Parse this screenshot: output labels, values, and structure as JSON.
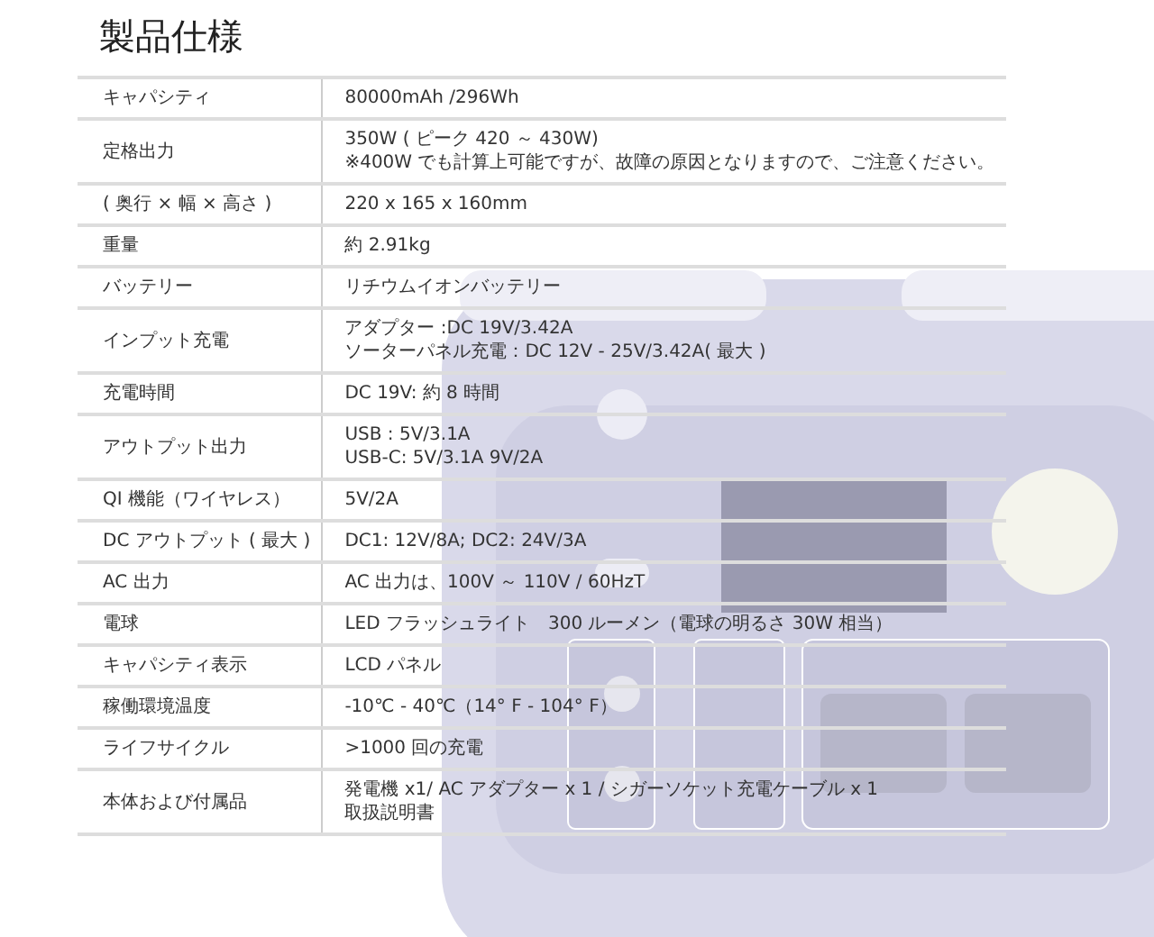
{
  "title": "製品仕様",
  "specs": [
    {
      "label": "キャパシティ",
      "lines": [
        "80000mAh /296Wh"
      ]
    },
    {
      "label": "定格出力",
      "lines": [
        "350W ( ピーク 420 ～ 430W)",
        "※400W でも計算上可能ですが、故障の原因となりますので、ご注意ください。"
      ]
    },
    {
      "label": "( 奥行 × 幅 × 高さ )",
      "lines": [
        "220 x 165 x 160mm"
      ]
    },
    {
      "label": "重量",
      "lines": [
        "約 2.91kg"
      ]
    },
    {
      "label": "バッテリー",
      "lines": [
        "リチウムイオンバッテリー"
      ]
    },
    {
      "label": "インプット充電",
      "lines": [
        "アダプター :DC 19V/3.42A",
        "ソーターパネル充電：DC 12V - 25V/3.42A( 最大 )"
      ]
    },
    {
      "label": "充電時間",
      "lines": [
        "DC 19V: 約 8 時間"
      ]
    },
    {
      "label": "アウトプット出力",
      "lines": [
        "USB : 5V/3.1A",
        "USB-C: 5V/3.1A 9V/2A"
      ]
    },
    {
      "label": "QI 機能（ワイヤレス）",
      "lines": [
        "5V/2A"
      ]
    },
    {
      "label": "DC アウトプット ( 最大 )",
      "lines": [
        "DC1: 12V/8A; DC2: 24V/3A"
      ]
    },
    {
      "label": "AC 出力",
      "lines": [
        "AC 出力は、100V ～ 110V / 60HzT"
      ]
    },
    {
      "label": "電球",
      "lines": [
        "LED フラッシュライト　300 ルーメン（電球の明るさ 30W 相当）"
      ]
    },
    {
      "label": "キャパシティ表示",
      "lines": [
        "LCD パネル"
      ]
    },
    {
      "label": "稼働環境温度",
      "lines": [
        "-10℃ - 40℃（14° F - 104° F）"
      ]
    },
    {
      "label": "ライフサイクル",
      "lines": [
        ">1000 回の充電"
      ]
    },
    {
      "label": "本体および付属品",
      "lines": [
        "発電機 x1/ AC アダプター x 1 / シガーソケット充電ケーブル x 1",
        "取扱説明書"
      ]
    }
  ]
}
